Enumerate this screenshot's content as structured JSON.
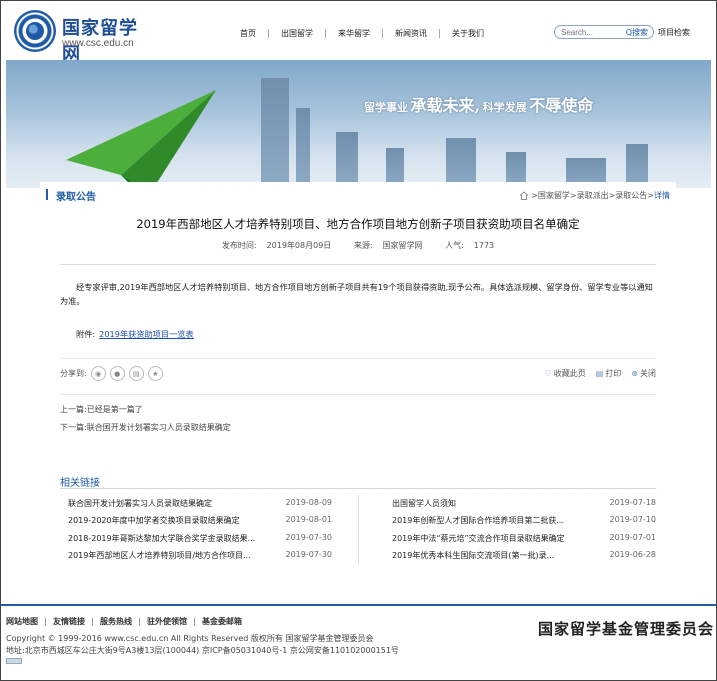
{
  "header": {
    "logo_title": "国家留学网",
    "logo_url": "www.csc.edu.cn",
    "nav": [
      "首页",
      "出国留学",
      "来华留学",
      "新闻资讯",
      "关于我们"
    ],
    "search_placeholder": "Search...",
    "search_button": "Q搜索",
    "project_search": "项目检索"
  },
  "banner": {
    "slogan_small_1": "留学事业",
    "slogan_big_1": "承载未来,",
    "slogan_small_2": "科学发展",
    "slogan_big_2": "不辱使命"
  },
  "section": {
    "title": "录取公告",
    "breadcrumb": [
      "国家留学",
      "录取派出",
      "录取公告"
    ],
    "breadcrumb_current": "详情",
    "sep": " > "
  },
  "article": {
    "title": "2019年西部地区人才培养特别项目、地方合作项目地方创新子项目获资助项目名单确定",
    "published_label": "发布时间:",
    "published": "2019年08月09日",
    "source_label": "来源:",
    "source": "国家留学网",
    "views_label": "人气:",
    "views": "1773",
    "body": "经专家评审,2019年西部地区人才培养特别项目、地方合作项目地方创新子项目共有19个项目获得资助,现予公布。具体选派规模、留学身份、留学专业等以通知为准。",
    "attachment_label": "附件:",
    "attachment_link": "2019年获资助项目一览表"
  },
  "share": {
    "label": "分享到:",
    "icons": [
      "weibo-icon",
      "wechat-icon",
      "doc-icon",
      "star-icon"
    ]
  },
  "tools": {
    "favorite": "收藏此页",
    "print": "打印",
    "close": "关闭"
  },
  "prev_next": {
    "prev_label": "上一篇:",
    "prev_value": "已经是第一篇了",
    "next_label": "下一篇:",
    "next_value": "联合国开发计划署实习人员录取结果确定"
  },
  "related": {
    "title": "相关链接",
    "left": [
      {
        "text": "联合国开发计划署实习人员录取结果确定",
        "date": "2019-08-09"
      },
      {
        "text": "2019-2020年度中加学者交换项目录取结果确定",
        "date": "2019-08-01"
      },
      {
        "text": "2018-2019年哥斯达黎加大学联合奖学金录取结果...",
        "date": "2019-07-30"
      },
      {
        "text": "2019年西部地区人才培养特别项目/地方合作项目...",
        "date": "2019-07-30"
      }
    ],
    "right": [
      {
        "text": "出国留学人员须知",
        "date": "2019-07-18"
      },
      {
        "text": "2019年创新型人才国际合作培养项目第二批获...",
        "date": "2019-07-10"
      },
      {
        "text": "2019年中法“蔡元培”交流合作项目录取结果确定",
        "date": "2019-07-01"
      },
      {
        "text": "2019年优秀本科生国际交流项目(第一批)录...",
        "date": "2019-06-28"
      }
    ]
  },
  "footer": {
    "links": [
      "网站地图",
      "友情链接",
      "服务热线",
      "驻外使领馆",
      "基金委邮箱"
    ],
    "copyright": "Copyright © 1999-2016 www.csc.edu.cn All Rights Reserved  版权所有 国家留学基金管理委员会",
    "address": "地址:北京市西城区车公庄大街9号A3楼13层(100044)  京ICP备05031040号-1  京公网安备110102000151号",
    "brand": "国家留学基金管理委员会"
  },
  "colors": {
    "brand_blue": "#1e5aa5",
    "link_blue": "#1e4fb0"
  }
}
